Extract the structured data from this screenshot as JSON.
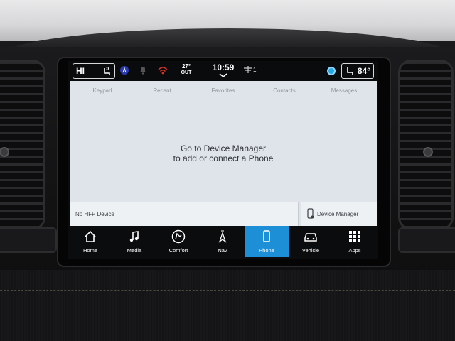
{
  "status_bar": {
    "climate_left": "HI",
    "outside_temp": "27°",
    "outside_label": "OUT",
    "clock": "10:59",
    "fan_speed": "1",
    "climate_right": "84°",
    "icons": [
      "seat-heat-icon",
      "driver-assist-icon",
      "notification-bell-icon",
      "wifi-icon",
      "fan-icon",
      "alexa-icon",
      "seat-heat-right-icon"
    ]
  },
  "phone": {
    "tabs": [
      "Keypad",
      "Recent",
      "Favorites",
      "Contacts",
      "Messages"
    ],
    "message_line1": "Go to Device Manager",
    "message_line2": "to add or connect a Phone",
    "hfp_status": "No HFP Device",
    "device_manager_label": "Device Manager"
  },
  "nav": {
    "items": [
      {
        "label": "Home",
        "icon": "home-icon"
      },
      {
        "label": "Media",
        "icon": "music-note-icon"
      },
      {
        "label": "Comfort",
        "icon": "comfort-icon"
      },
      {
        "label": "Nav",
        "icon": "navigation-arrow-icon"
      },
      {
        "label": "Phone",
        "icon": "phone-icon"
      },
      {
        "label": "Vehicle",
        "icon": "car-icon"
      },
      {
        "label": "Apps",
        "icon": "apps-grid-icon"
      }
    ],
    "active": "Phone"
  },
  "colors": {
    "active_tab": "#1c8fd6",
    "panel_bg": "#dfe4ea",
    "alexa": "#25a8e0"
  }
}
